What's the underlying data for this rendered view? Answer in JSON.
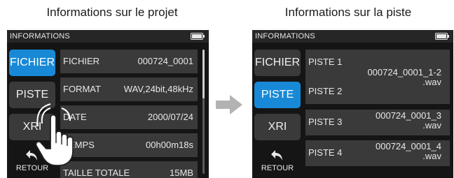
{
  "captions": {
    "left": "Informations sur le projet",
    "right": "Informations sur la piste"
  },
  "left_screen": {
    "title": "INFORMATIONS",
    "side": [
      "FICHIER",
      "PISTE",
      "XRI"
    ],
    "back": "RETOUR",
    "rows": [
      {
        "label": "FICHIER",
        "value": "000724_0001"
      },
      {
        "label": "FORMAT",
        "value": "WAV,24bit,48kHz"
      },
      {
        "label": "DATE",
        "value": "2000/07/24"
      },
      {
        "label": "TEMPS",
        "value": "00h00m18s"
      },
      {
        "label": "TAILLE TOTALE",
        "value": "15MB"
      }
    ]
  },
  "right_screen": {
    "title": "INFORMATIONS",
    "side": [
      "FICHIER",
      "PISTE",
      "XRI"
    ],
    "back": "RETOUR",
    "rows": [
      {
        "label": "PISTE 1",
        "value_line1": "000724_0001_1-2",
        "value_line2": ".wav"
      },
      {
        "label": "PISTE 2",
        "value_line1": "",
        "value_line2": ""
      },
      {
        "label": "PISTE 3",
        "value_line1": "000724_0001_3",
        "value_line2": ".wav"
      },
      {
        "label": "PISTE 4",
        "value_line1": "000724_0001_4",
        "value_line2": ".wav"
      }
    ]
  },
  "icons": {
    "battery": "battery-icon",
    "back": "back-arrow-icon",
    "transition": "right-arrow-icon",
    "hand": "tap-hand-icon"
  },
  "colors": {
    "accent": "#1889d6",
    "screen_bg": "#151515",
    "row_bg": "#3a3a3a"
  }
}
